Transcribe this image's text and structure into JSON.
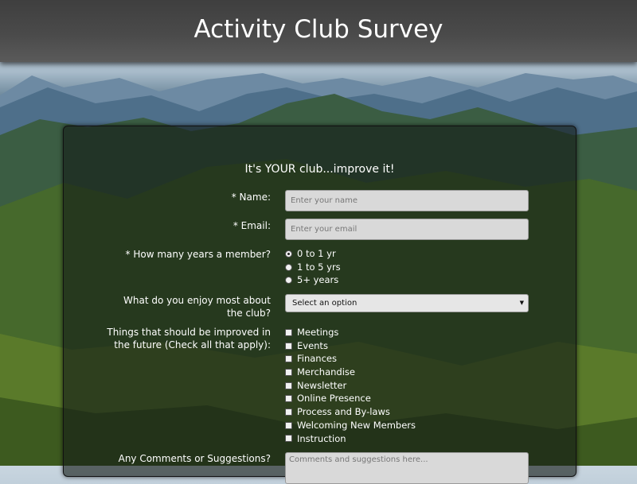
{
  "header": {
    "title": "Activity Club Survey"
  },
  "form": {
    "tagline": "It's YOUR club...improve it!",
    "name": {
      "label": "* Name:",
      "placeholder": "Enter your name",
      "value": ""
    },
    "email": {
      "label": "* Email:",
      "placeholder": "Enter your email",
      "value": ""
    },
    "years": {
      "label": "* How many years a member?",
      "options": [
        "0 to 1 yr",
        "1 to 5 yrs",
        "5+ years"
      ],
      "selected": "0 to 1 yr"
    },
    "enjoy": {
      "label": "What do you enjoy most about the club?",
      "selected": "Select an option"
    },
    "improve": {
      "label": "Things that should be improved in the future (Check all that apply):",
      "options": [
        "Meetings",
        "Events",
        "Finances",
        "Merchandise",
        "Newsletter",
        "Online Presence",
        "Process and By-laws",
        "Welcoming New Members",
        "Instruction"
      ]
    },
    "comments": {
      "label": "Any Comments or Suggestions?",
      "placeholder": "Comments and suggestions here..."
    }
  },
  "colors": {
    "header": "#4a4a4a",
    "panel": "rgba(20,28,22,0.62)",
    "field": "#d9d9d9"
  },
  "icons": {
    "select": "triangle-down-icon"
  }
}
